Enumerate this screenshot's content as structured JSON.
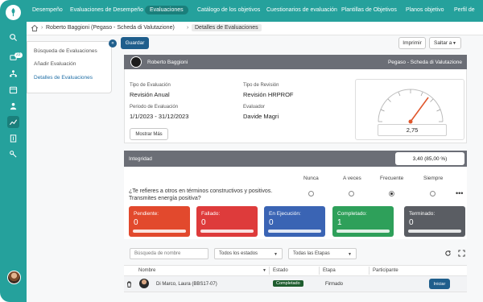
{
  "nav": {
    "items": [
      "Desempeño",
      "Evaluaciones de Desempeño",
      "Evaluaciones",
      "Catálogo de los objetivos",
      "Cuestionarios de evaluación",
      "Plantillas de Objetivos",
      "Planos objetivo",
      "Perfil de"
    ],
    "active": "Evaluaciones"
  },
  "sidebar": {
    "badge": "22",
    "icons": [
      "search-icon",
      "notifications-icon",
      "org-icon",
      "calendar-icon",
      "people-icon",
      "chart-icon",
      "building-icon",
      "key-icon"
    ]
  },
  "breadcrumb": {
    "parent": "Roberto Baggioni (Pegaso - Scheda di Valutazione)",
    "current": "Detalles de Evaluaciones"
  },
  "sidemenu": {
    "items": [
      "Búsqueda de Evaluaciones",
      "Añadir Evaluación",
      "Detalles de Evaluaciones"
    ]
  },
  "toolbar": {
    "save": "Guardar",
    "print": "Imprimir",
    "jump": "Saltar a"
  },
  "evaluation": {
    "name": "Roberto Baggioni",
    "scheme": "Pegaso - Scheda di Valutazione",
    "type_label": "Tipo de Evaluación",
    "type_value": "Revisión Anual",
    "review_label": "Tipo de Revisión",
    "review_value": "Revisión HRPROF",
    "period_label": "Periodo de Evaluación",
    "period_value": "1/1/2023 - 31/12/2023",
    "evaluator_label": "Evaluador",
    "evaluator_value": "Davide Magri",
    "show_more": "Mostrar Más",
    "score": "2,75"
  },
  "integridad": {
    "label": "Integridad",
    "value": "3,40 (85,00 %)"
  },
  "question": {
    "options": [
      "Nunca",
      "A veces",
      "Frecuente",
      "Siempre"
    ],
    "text": "¿Te refieres a otros en términos constructivos y positivos. Transmites energía positiva?",
    "selected": "Frecuente"
  },
  "stats": [
    {
      "label": "Pendiente:",
      "value": "0",
      "color": "#e2492d"
    },
    {
      "label": "Fallado:",
      "value": "0",
      "color": "#de3b3b"
    },
    {
      "label": "En Ejecución:",
      "value": "0",
      "color": "#3a64b4"
    },
    {
      "label": "Completado:",
      "value": "1",
      "color": "#2ea05a"
    },
    {
      "label": "Terminado:",
      "value": "0",
      "color": "#5a5d63"
    }
  ],
  "filters": {
    "search_placeholder": "Búsqueda de nombre",
    "states": "Todos los estados",
    "stages": "Todas las Etapas"
  },
  "table": {
    "headers": [
      "Nombre",
      "Estado",
      "Etapa",
      "Participante"
    ],
    "rows": [
      {
        "name": "Di Marco, Laura (BBS17-07)",
        "status": "Completado",
        "stage": "Firmado",
        "action": "Iniciar"
      }
    ]
  }
}
